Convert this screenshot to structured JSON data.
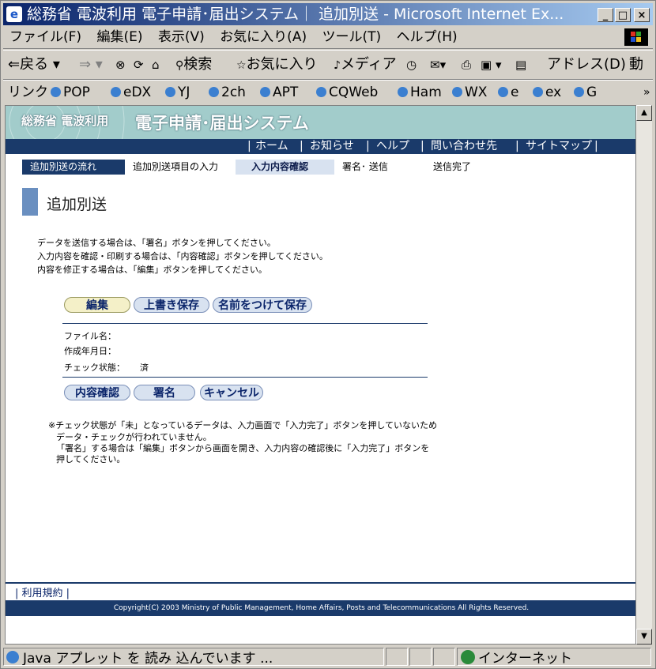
{
  "window": {
    "title": "総務省 電波利用 電子申請･届出システム｜ 追加別送 - Microsoft Internet Ex...",
    "controls": [
      "_",
      "□",
      "×"
    ]
  },
  "menu": [
    "ファイル(F)",
    "編集(E)",
    "表示(V)",
    "お気に入り(A)",
    "ツール(T)",
    "ヘルプ(H)"
  ],
  "toolbar": {
    "back": "戻る",
    "search": "検索",
    "favorites": "お気に入り",
    "media": "メディア",
    "address": "アドレス(D)",
    "go": "動"
  },
  "links": {
    "label": "リンク",
    "items": [
      "POP",
      "eDX",
      "YJ",
      "2ch",
      "APT",
      "CQWeb",
      "Ham",
      "WX",
      "e",
      "ex",
      "G"
    ]
  },
  "site": {
    "logo_small": "総務省 電波利用",
    "logo_main": "電子申請･届出システム",
    "nav": [
      "ホーム",
      "お知らせ",
      "ヘルプ",
      "問い合わせ先",
      "サイトマップ"
    ]
  },
  "flow": {
    "label": "追加別送の流れ",
    "steps": [
      "追加別送項目の入力",
      "入力内容確認",
      "署名･ 送信",
      "送信完了"
    ]
  },
  "page": {
    "title": "追加別送",
    "instructions": [
      "データを送信する場合は、「署名」ボタンを押してください。",
      "入力内容を確認・印刷する場合は、「内容確認」ボタンを押してください。",
      "内容を修正する場合は、「編集」ボタンを押してください。"
    ],
    "buttons_top": [
      "編集",
      "上書き保存",
      "名前をつけて保存"
    ],
    "fields": [
      {
        "label": "ファイル名：",
        "value": ""
      },
      {
        "label": "作成年月日：",
        "value": ""
      },
      {
        "label": "チェック状態：",
        "value": "済"
      }
    ],
    "buttons_bottom": [
      "内容確認",
      "署名",
      "キャンセル"
    ],
    "notes": [
      "※チェック状態が「未」となっているデータは、入力画面で「入力完了」ボタンを押していないため",
      "データ・チェックが行われていません。",
      "「署名」する場合は「編集」ボタンから画面を開き、入力内容の確認後に「入力完了」ボタンを",
      "押してください。"
    ]
  },
  "footer": {
    "link": "利用規約",
    "copyright": "Copyright(C) 2003 Ministry of Public Management, Home Affairs, Posts and Telecommunications All Rights Reserved."
  },
  "status": {
    "text": "Java アプレット を 読み 込んでいます ...",
    "zone": "インターネット"
  },
  "colors": {
    "header": "#a2cccb",
    "navy": "#1a3a6a",
    "title_bar": "#0a246a"
  }
}
